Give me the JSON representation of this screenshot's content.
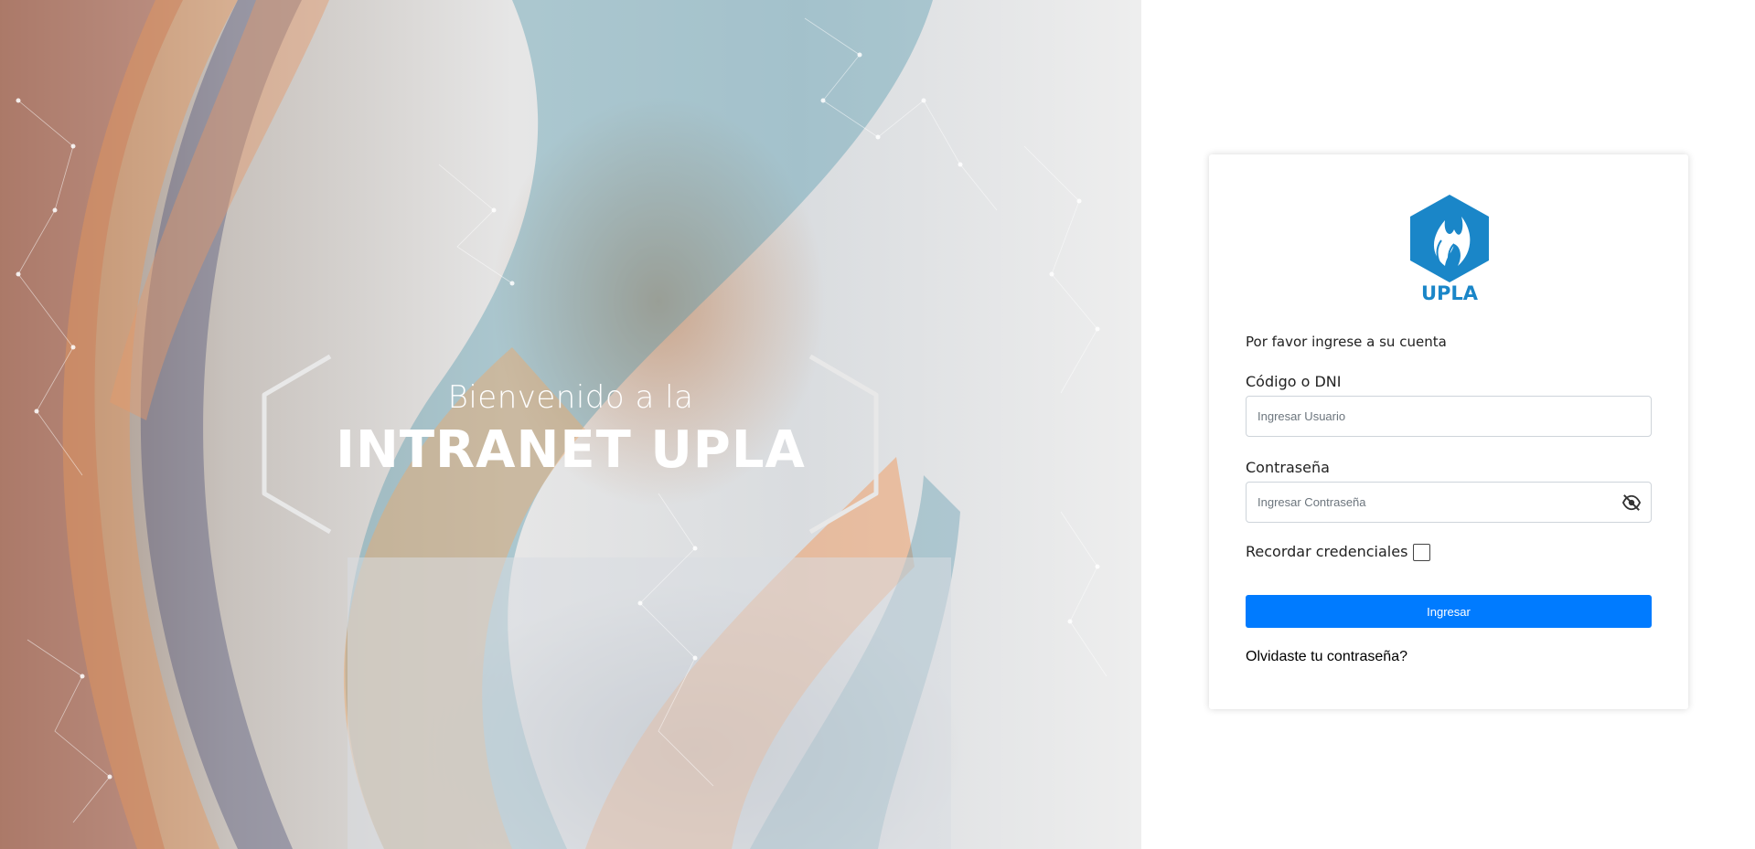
{
  "hero": {
    "welcome": "Bienvenido a la",
    "title": "INTRANET UPLA"
  },
  "login": {
    "logo_text": "UPLA",
    "subtitle": "Por favor ingrese a su cuenta",
    "user_label": "Código o DNI",
    "user_placeholder": "Ingresar Usuario",
    "user_value": "",
    "password_label": "Contraseña",
    "password_placeholder": "Ingresar Contraseña",
    "password_value": "",
    "password_toggle_icon": "eye-slash-icon",
    "remember_label": "Recordar credenciales",
    "remember_checked": false,
    "submit_label": "Ingresar",
    "forgot_label": "Olvidaste tu contraseña?"
  },
  "colors": {
    "primary": "#007bff",
    "brand_blue": "#1a86c8"
  }
}
